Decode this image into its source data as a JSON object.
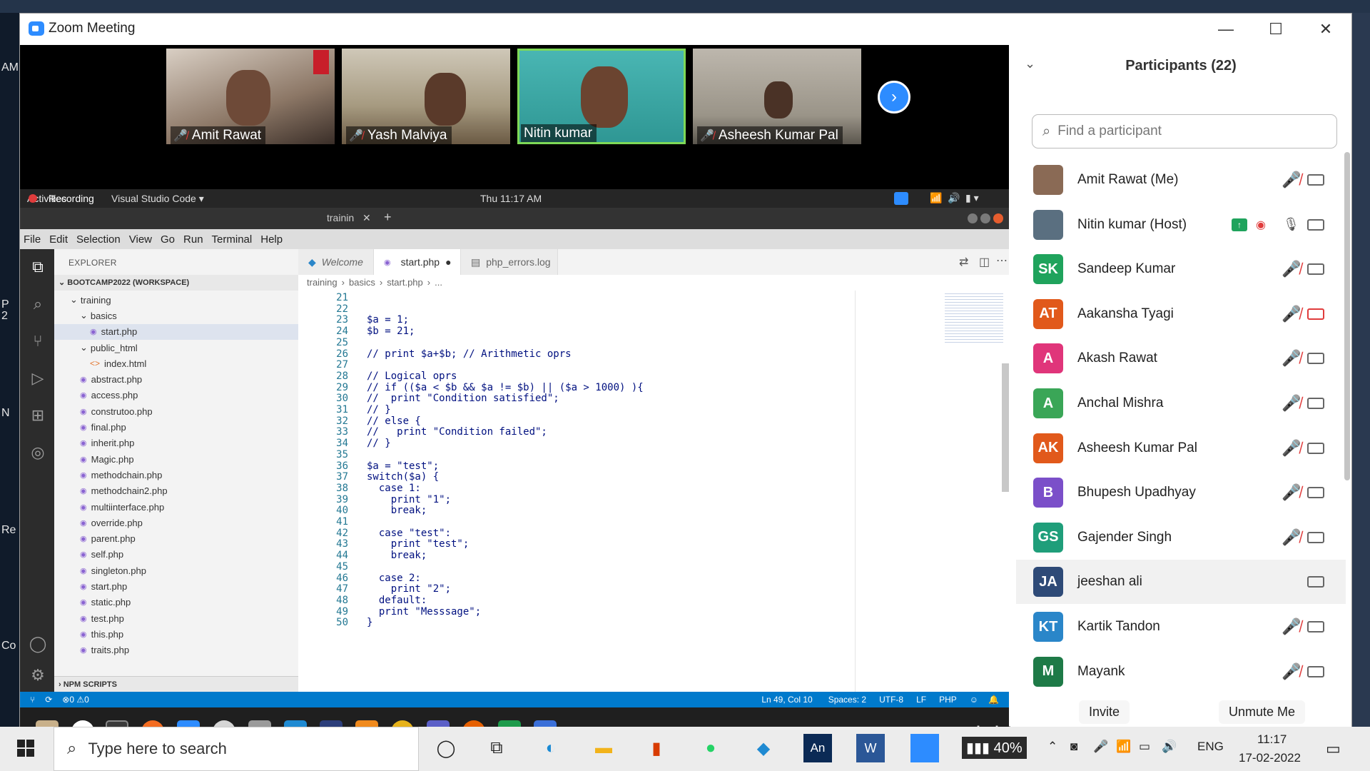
{
  "window": {
    "title": "Zoom Meeting",
    "minimize": "—",
    "maximize": "☐",
    "close": "✕"
  },
  "desktop_fragments": [
    "AM",
    "Re",
    "Co",
    "P",
    "2",
    "N"
  ],
  "videos": [
    {
      "name": "Amit Rawat",
      "muted": true
    },
    {
      "name": "Yash Malviya",
      "muted": true
    },
    {
      "name": "Nitin kumar",
      "muted": false
    },
    {
      "name": "Asheesh Kumar Pal",
      "muted": true
    }
  ],
  "next_label": "›",
  "share": {
    "top_left": "Activities",
    "recording": "Recording",
    "app_menu": "Visual Studio Code ▾",
    "clock": "Thu 11:17 AM",
    "window_tab": "trainin",
    "menu": [
      "File",
      "Edit",
      "Selection",
      "View",
      "Go",
      "Run",
      "Terminal",
      "Help"
    ],
    "explorer_title": "EXPLORER",
    "workspace": "BOOTCAMP2022 (WORKSPACE)",
    "tree": [
      {
        "label": "training",
        "indent": 1,
        "type": "folder"
      },
      {
        "label": "basics",
        "indent": 2,
        "type": "folder"
      },
      {
        "label": "start.php",
        "indent": 3,
        "type": "php",
        "selected": true
      },
      {
        "label": "public_html",
        "indent": 2,
        "type": "folder"
      },
      {
        "label": "index.html",
        "indent": 3,
        "type": "html"
      },
      {
        "label": "abstract.php",
        "indent": 2,
        "type": "php"
      },
      {
        "label": "access.php",
        "indent": 2,
        "type": "php"
      },
      {
        "label": "construtoo.php",
        "indent": 2,
        "type": "php"
      },
      {
        "label": "final.php",
        "indent": 2,
        "type": "php"
      },
      {
        "label": "inherit.php",
        "indent": 2,
        "type": "php"
      },
      {
        "label": "Magic.php",
        "indent": 2,
        "type": "php"
      },
      {
        "label": "methodchain.php",
        "indent": 2,
        "type": "php"
      },
      {
        "label": "methodchain2.php",
        "indent": 2,
        "type": "php"
      },
      {
        "label": "multiinterface.php",
        "indent": 2,
        "type": "php"
      },
      {
        "label": "override.php",
        "indent": 2,
        "type": "php"
      },
      {
        "label": "parent.php",
        "indent": 2,
        "type": "php"
      },
      {
        "label": "self.php",
        "indent": 2,
        "type": "php"
      },
      {
        "label": "singleton.php",
        "indent": 2,
        "type": "php"
      },
      {
        "label": "start.php",
        "indent": 2,
        "type": "php"
      },
      {
        "label": "static.php",
        "indent": 2,
        "type": "php"
      },
      {
        "label": "test.php",
        "indent": 2,
        "type": "php"
      },
      {
        "label": "this.php",
        "indent": 2,
        "type": "php"
      },
      {
        "label": "traits.php",
        "indent": 2,
        "type": "php"
      }
    ],
    "npm": "NPM SCRIPTS",
    "tabs": [
      "Welcome",
      "start.php",
      "php_errors.log"
    ],
    "breadcrumb": [
      "training",
      "basics",
      "start.php",
      "..."
    ],
    "code": [
      {
        "n": "21",
        "t": "",
        "c": ""
      },
      {
        "n": "22",
        "t": "",
        "c": ""
      },
      {
        "n": "23",
        "t": "$a = 1;",
        "c": ""
      },
      {
        "n": "24",
        "t": "$b = 21;",
        "c": ""
      },
      {
        "n": "25",
        "t": "",
        "c": ""
      },
      {
        "n": "26",
        "t": "// print $a+$b; // Arithmetic oprs",
        "c": "com"
      },
      {
        "n": "27",
        "t": "",
        "c": ""
      },
      {
        "n": "28",
        "t": "// Logical oprs",
        "c": "com"
      },
      {
        "n": "29",
        "t": "// if (($a < $b && $a != $b) || ($a > 1000) ){",
        "c": "com"
      },
      {
        "n": "30",
        "t": "//  print \"Condition satisfied\";",
        "c": "com"
      },
      {
        "n": "31",
        "t": "// }",
        "c": "com"
      },
      {
        "n": "32",
        "t": "// else {",
        "c": "com"
      },
      {
        "n": "33",
        "t": "//   print \"Condition failed\";",
        "c": "com"
      },
      {
        "n": "34",
        "t": "// }",
        "c": "com"
      },
      {
        "n": "35",
        "t": "",
        "c": ""
      },
      {
        "n": "36",
        "t": "$a = \"test\";",
        "c": ""
      },
      {
        "n": "37",
        "t": "switch($a) {",
        "c": "kw"
      },
      {
        "n": "38",
        "t": "  case 1:",
        "c": "kw"
      },
      {
        "n": "39",
        "t": "    print \"1\";",
        "c": ""
      },
      {
        "n": "40",
        "t": "    break;",
        "c": "kw"
      },
      {
        "n": "41",
        "t": "",
        "c": ""
      },
      {
        "n": "42",
        "t": "  case \"test\":",
        "c": "kw"
      },
      {
        "n": "43",
        "t": "    print \"test\";",
        "c": ""
      },
      {
        "n": "44",
        "t": "    break;",
        "c": "kw"
      },
      {
        "n": "45",
        "t": "",
        "c": ""
      },
      {
        "n": "46",
        "t": "  case 2:",
        "c": "kw"
      },
      {
        "n": "47",
        "t": "    print \"2\";",
        "c": ""
      },
      {
        "n": "48",
        "t": "  default:",
        "c": "kw"
      },
      {
        "n": "49",
        "t": "  print \"Messsage\";",
        "c": ""
      },
      {
        "n": "50",
        "t": "}",
        "c": ""
      }
    ],
    "status_left": "⊗0 ⚠0",
    "status_right": [
      "Ln 49, Col 10",
      "Spaces: 2",
      "UTF-8",
      "LF",
      "PHP"
    ]
  },
  "participants": {
    "title": "Participants (22)",
    "search_placeholder": "Find a participant",
    "list": [
      {
        "name": "Amit Rawat (Me)",
        "initials": "",
        "color": "#8a6a55",
        "muted": true,
        "video_off": false
      },
      {
        "name": "Nitin kumar (Host)",
        "initials": "",
        "color": "#5a6f80",
        "muted": false,
        "video_off": false
      },
      {
        "name": "Sandeep Kumar",
        "initials": "SK",
        "color": "#1fa35c",
        "muted": true,
        "video_off": false
      },
      {
        "name": "Aakansha Tyagi",
        "initials": "AT",
        "color": "#e1591b",
        "muted": true,
        "video_off": true
      },
      {
        "name": "Akash Rawat",
        "initials": "A",
        "color": "#e0357a",
        "muted": true,
        "video_off": false
      },
      {
        "name": "Anchal Mishra",
        "initials": "A",
        "color": "#3aa657",
        "muted": true,
        "video_off": false
      },
      {
        "name": "Asheesh Kumar Pal",
        "initials": "AK",
        "color": "#e1591b",
        "muted": true,
        "video_off": false
      },
      {
        "name": "Bhupesh Upadhyay",
        "initials": "B",
        "color": "#7b4fc9",
        "muted": true,
        "video_off": false
      },
      {
        "name": "Gajender Singh",
        "initials": "GS",
        "color": "#1f9e7a",
        "muted": true,
        "video_off": false
      },
      {
        "name": "jeeshan ali",
        "initials": "JA",
        "color": "#2e4a77",
        "muted": false,
        "video_off": false
      },
      {
        "name": "Kartik Tandon",
        "initials": "KT",
        "color": "#2a86c9",
        "muted": true,
        "video_off": false
      },
      {
        "name": "Mayank",
        "initials": "M",
        "color": "#1e7a47",
        "muted": true,
        "video_off": false
      }
    ],
    "invite": "Invite",
    "unmute": "Unmute Me"
  },
  "taskbar": {
    "search_placeholder": "Type here to search",
    "battery": "40%",
    "lang": "ENG",
    "time": "11:17",
    "date": "17-02-2022"
  },
  "colors": {
    "zoom_blue": "#2d8cff",
    "vscode_blue": "#007acc",
    "mute_red": "#e03c3c"
  }
}
